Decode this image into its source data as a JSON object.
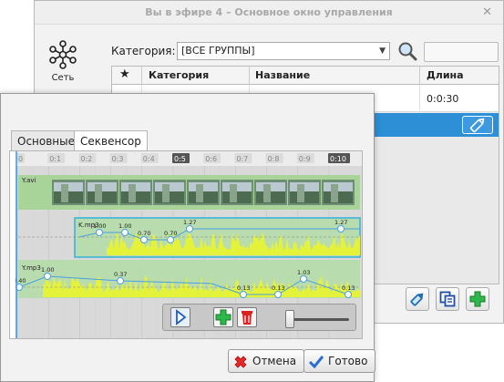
{
  "main_window": {
    "title": "Вы в эфире 4 – Основное окно управления",
    "close_glyph": "✕",
    "sidebar": {
      "network_label": "Сеть"
    },
    "category_label": "Категория:",
    "category_value": "[ВСЕ ГРУППЫ]",
    "grid": {
      "columns": [
        "Категория",
        "Название",
        "Длина"
      ],
      "rows": [
        {
          "category": "",
          "name": "",
          "length": "0:0:30"
        }
      ]
    }
  },
  "dialog": {
    "tabs": [
      "Основные",
      "Секвенсор"
    ],
    "active_tab": 1,
    "ruler": [
      "0",
      "0:1",
      "0:2",
      "0:3",
      "0:4",
      "0:5",
      "0:6",
      "0:7",
      "0:8",
      "0:9",
      "0:10"
    ],
    "tracks": {
      "video": {
        "name": "Y.avi"
      },
      "audio1": {
        "name": "K.mp3",
        "points": [
          "1.00",
          "1.00",
          "0.70",
          "0.70",
          "1.27",
          "1.27"
        ]
      },
      "audio2": {
        "name": "Y.mp3",
        "points": [
          "0.40",
          "1.00",
          "0.37",
          "0.13",
          "0.13",
          "1.03",
          "0.13"
        ]
      }
    },
    "cancel_label": "Отмена",
    "ok_label": "Готово"
  },
  "colors": {
    "accent": "#2d8fd6",
    "track_green": "#a8d49a",
    "wave_yellow": "#e6f23a",
    "env_blue": "#4aa0e0"
  }
}
